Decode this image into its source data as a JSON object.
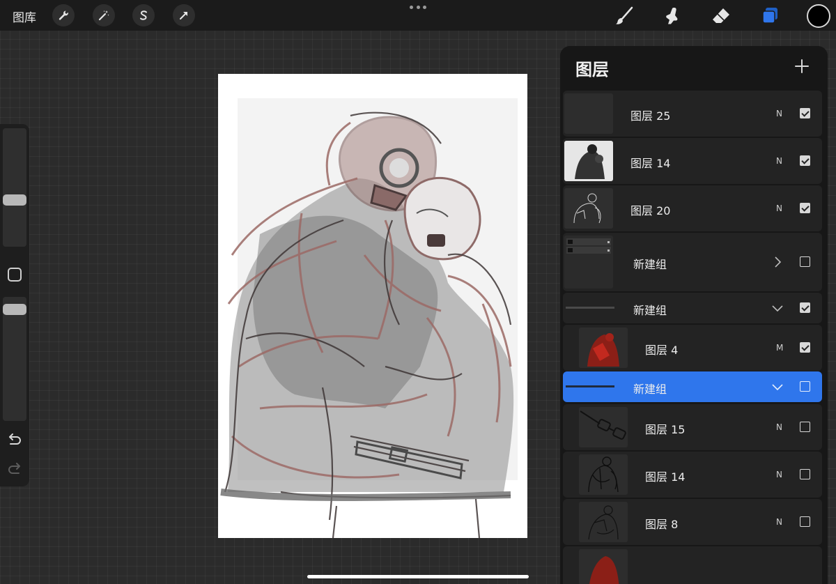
{
  "topbar": {
    "gallery_label": "图库",
    "left_tools": [
      "wrench-icon",
      "magic-wand-icon",
      "selection-s-icon",
      "transform-arrow-icon"
    ],
    "right_tools": [
      "brush-icon",
      "smudge-icon",
      "eraser-icon",
      "layers-icon"
    ],
    "active_tool": "layers-icon",
    "current_color": "#000000",
    "accent_color": "#2f76ec"
  },
  "sidebar": {
    "brush_size_level": 0.3,
    "opacity_level": 0.95
  },
  "layers": {
    "title": "图层",
    "items": [
      {
        "name": "图层 25",
        "blend": "N",
        "visible": true,
        "type": "layer",
        "indent": 0
      },
      {
        "name": "图层 14",
        "blend": "N",
        "visible": true,
        "type": "layer",
        "indent": 0
      },
      {
        "name": "图层 20",
        "blend": "N",
        "visible": true,
        "type": "layer",
        "indent": 0
      },
      {
        "name": "新建组",
        "blend": "",
        "visible": false,
        "type": "group-collapsed",
        "indent": 0
      },
      {
        "name": "新建组",
        "blend": "",
        "visible": true,
        "type": "group-expanded",
        "indent": 0
      },
      {
        "name": "图层 4",
        "blend": "M",
        "visible": true,
        "type": "layer",
        "indent": 1
      },
      {
        "name": "新建组",
        "blend": "",
        "visible": false,
        "type": "group-expanded",
        "indent": 0,
        "selected": true
      },
      {
        "name": "图层 15",
        "blend": "N",
        "visible": false,
        "type": "layer",
        "indent": 1
      },
      {
        "name": "图层 14",
        "blend": "N",
        "visible": false,
        "type": "layer",
        "indent": 1
      },
      {
        "name": "图层 8",
        "blend": "N",
        "visible": false,
        "type": "layer",
        "indent": 1
      }
    ]
  }
}
